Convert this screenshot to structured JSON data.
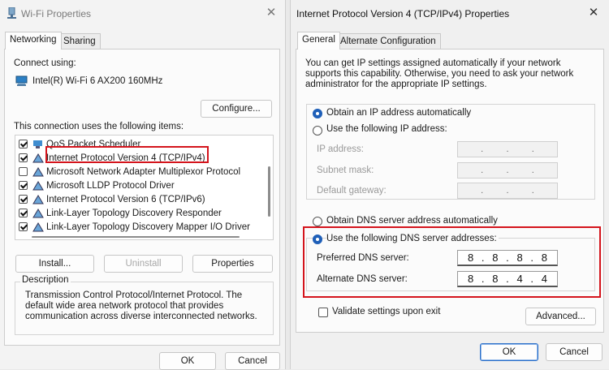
{
  "wifi": {
    "title": "Wi-Fi Properties",
    "tabs": [
      "Networking",
      "Sharing"
    ],
    "connect_using_label": "Connect using:",
    "adapter_name": "Intel(R) Wi-Fi 6 AX200 160MHz",
    "configure_button": "Configure...",
    "items_label": "This connection uses the following items:",
    "items": [
      {
        "label": "QoS Packet Scheduler",
        "checked": true
      },
      {
        "label": "Internet Protocol Version 4 (TCP/IPv4)",
        "checked": true
      },
      {
        "label": "Microsoft Network Adapter Multiplexor Protocol",
        "checked": false
      },
      {
        "label": "Microsoft LLDP Protocol Driver",
        "checked": true
      },
      {
        "label": "Internet Protocol Version 6 (TCP/IPv6)",
        "checked": true
      },
      {
        "label": "Link-Layer Topology Discovery Responder",
        "checked": true
      },
      {
        "label": "Link-Layer Topology Discovery Mapper I/O Driver",
        "checked": true
      }
    ],
    "install_button": "Install...",
    "uninstall_button": "Uninstall",
    "properties_button": "Properties",
    "description_label": "Description",
    "description_text": "Transmission Control Protocol/Internet Protocol. The default wide area network protocol that provides communication across diverse interconnected networks.",
    "ok_button": "OK",
    "cancel_button": "Cancel"
  },
  "ipv4": {
    "title": "Internet Protocol Version 4 (TCP/IPv4) Properties",
    "tabs": [
      "General",
      "Alternate Configuration"
    ],
    "intro_text": "You can get IP settings assigned automatically if your network supports this capability. Otherwise, you need to ask your network administrator for the appropriate IP settings.",
    "obtain_ip_auto": "Obtain an IP address automatically",
    "use_following_ip": "Use the following IP address:",
    "ip_address_label": "IP address:",
    "subnet_mask_label": "Subnet mask:",
    "default_gateway_label": "Default gateway:",
    "empty_ip": [
      ".",
      ".",
      "."
    ],
    "obtain_dns_auto": "Obtain DNS server address automatically",
    "use_following_dns": "Use the following DNS server addresses:",
    "preferred_dns_label": "Preferred DNS server:",
    "alternate_dns_label": "Alternate DNS server:",
    "preferred_dns": [
      "8",
      ".",
      "8",
      ".",
      "8",
      ".",
      "8"
    ],
    "alternate_dns": [
      "8",
      ".",
      "8",
      ".",
      "4",
      ".",
      "4"
    ],
    "validate_label": "Validate settings upon exit",
    "advanced_button": "Advanced...",
    "ok_button": "OK",
    "cancel_button": "Cancel"
  },
  "colors": {
    "highlight": "#d4141c",
    "accent": "#1e5fb8"
  }
}
